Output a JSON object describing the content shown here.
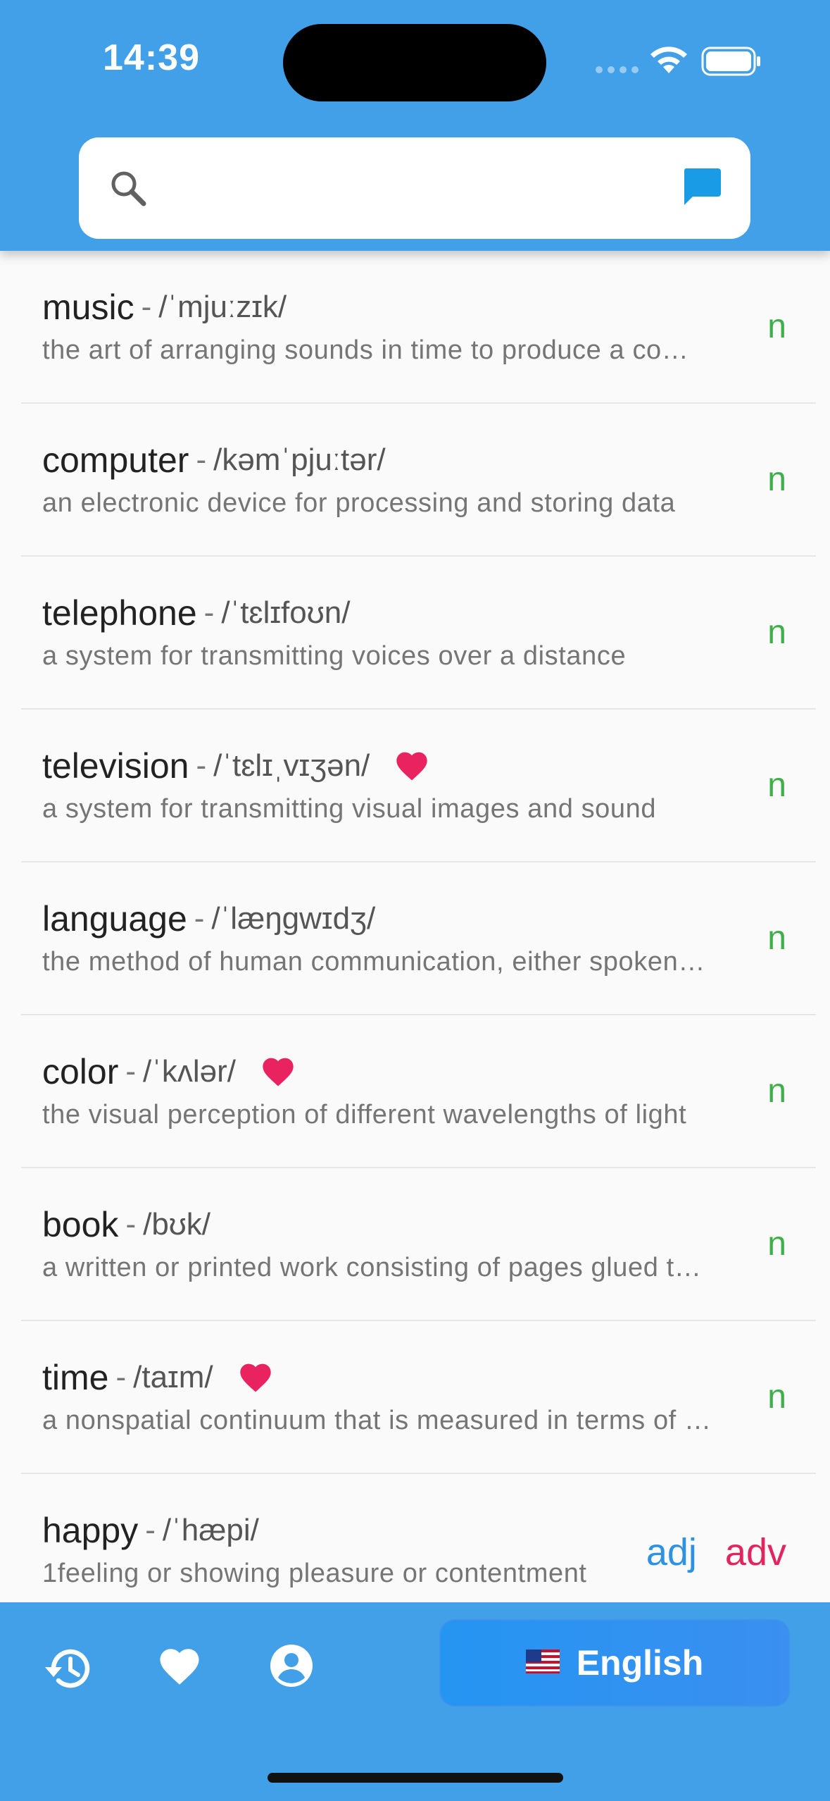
{
  "status_bar": {
    "time": "14:39"
  },
  "search": {
    "placeholder": "",
    "value": ""
  },
  "words": [
    {
      "word": "music",
      "separator": "-",
      "ipa": "/ˈmjuːzɪk/",
      "definition": "the art of arranging sounds in time to produce a composition",
      "favorite": false,
      "pos": [
        "n"
      ]
    },
    {
      "word": "computer",
      "separator": "-",
      "ipa": "/kəmˈpjuːtər/",
      "definition": "an electronic device for processing and storing data",
      "favorite": false,
      "pos": [
        "n"
      ]
    },
    {
      "word": "telephone",
      "separator": "-",
      "ipa": "/ˈtɛlɪfoʊn/",
      "definition": "a system for transmitting voices over a distance",
      "favorite": false,
      "pos": [
        "n"
      ]
    },
    {
      "word": "television",
      "separator": "-",
      "ipa": "/ˈtɛlɪˌvɪʒən/",
      "definition": "a system for transmitting visual images and sound",
      "favorite": true,
      "pos": [
        "n"
      ]
    },
    {
      "word": "language",
      "separator": "-",
      "ipa": "/ˈlæŋgwɪdʒ/",
      "definition": "the method of human communication, either spoken or written",
      "favorite": false,
      "pos": [
        "n"
      ]
    },
    {
      "word": "color",
      "separator": "-",
      "ipa": "/ˈkʌlər/",
      "definition": "the visual perception of different wavelengths of light",
      "favorite": true,
      "pos": [
        "n"
      ]
    },
    {
      "word": "book",
      "separator": "-",
      "ipa": "/bʊk/",
      "definition": "a written or printed work consisting of pages glued together",
      "favorite": false,
      "pos": [
        "n"
      ]
    },
    {
      "word": "time",
      "separator": "-",
      "ipa": "/taɪm/",
      "definition": "a nonspatial continuum that is measured in terms of events",
      "favorite": true,
      "pos": [
        "n"
      ]
    },
    {
      "word": "happy",
      "separator": "-",
      "ipa": "/ˈhæpi/",
      "definition": "1feeling or showing pleasure or contentment",
      "favorite": false,
      "pos": [
        "adj",
        "adv"
      ]
    }
  ],
  "bottom_bar": {
    "icons": [
      "history-icon",
      "favorites-heart-icon",
      "account-icon"
    ],
    "language": {
      "flag": "🇺🇸",
      "label": "English"
    }
  },
  "colors": {
    "primary": "#42a0e8",
    "noun": "#3faf4a",
    "adjective": "#2f92e0",
    "adverb": "#e1255f",
    "heart": "#e8235f"
  }
}
